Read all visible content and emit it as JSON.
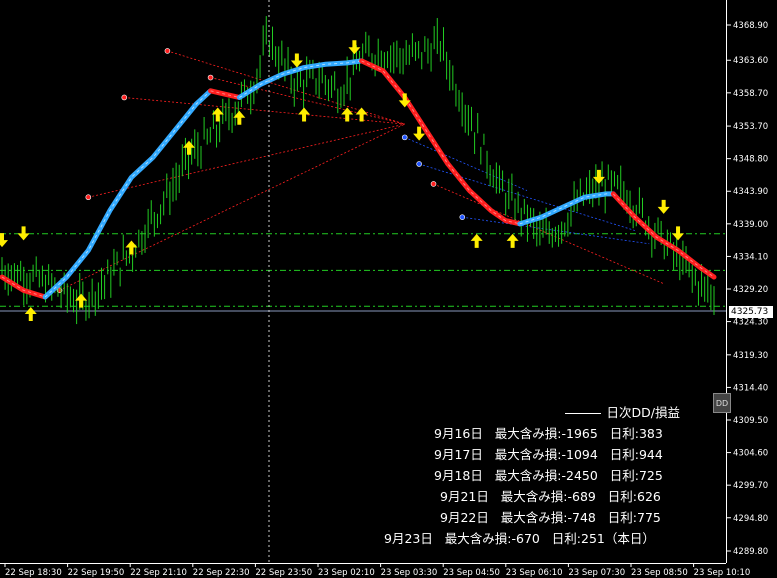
{
  "chart_data": {
    "type": "candlestick",
    "y_ticks": [
      "4368.90",
      "4363.60",
      "4358.70",
      "4353.70",
      "4348.80",
      "4343.90",
      "4339.00",
      "4334.10",
      "4329.20",
      "4324.30",
      "4319.30",
      "4314.40",
      "4309.50",
      "4304.60",
      "4299.70",
      "4294.80",
      "4289.80"
    ],
    "x_ticks": [
      "22 Sep 18:30",
      "22 Sep 19:50",
      "22 Sep 21:10",
      "22 Sep 22:30",
      "22 Sep 23:50",
      "23 Sep 02:10",
      "23 Sep 03:30",
      "23 Sep 04:50",
      "23 Sep 06:10",
      "23 Sep 07:30",
      "23 Sep 08:50",
      "23 Sep 10:10"
    ],
    "ylim": [
      4289.8,
      4372.0
    ],
    "current_price": "4325.73",
    "grid": false,
    "level_lines": [
      4337.5,
      4332.0,
      4326.6,
      4325.9
    ],
    "price_path": [
      [
        0,
        4332
      ],
      [
        4,
        4331
      ],
      [
        8,
        4329
      ],
      [
        11,
        4327
      ],
      [
        14,
        4330
      ],
      [
        18,
        4335
      ],
      [
        21,
        4340
      ],
      [
        24,
        4345
      ],
      [
        26,
        4349
      ],
      [
        29,
        4352
      ],
      [
        32,
        4356
      ],
      [
        35,
        4360
      ],
      [
        37,
        4367
      ],
      [
        39,
        4363
      ],
      [
        41,
        4360
      ],
      [
        44,
        4361
      ],
      [
        47,
        4359
      ],
      [
        50,
        4364
      ],
      [
        53,
        4365
      ],
      [
        56,
        4364
      ],
      [
        59,
        4365
      ],
      [
        61,
        4366
      ],
      [
        63,
        4360
      ],
      [
        65,
        4355
      ],
      [
        67,
        4350
      ],
      [
        69,
        4345
      ],
      [
        71,
        4342
      ],
      [
        73,
        4340
      ],
      [
        75,
        4337
      ],
      [
        78,
        4339
      ],
      [
        80,
        4342
      ],
      [
        82,
        4344
      ],
      [
        84,
        4345
      ],
      [
        86,
        4344
      ],
      [
        88,
        4342
      ],
      [
        90,
        4339
      ],
      [
        93,
        4335
      ],
      [
        96,
        4331
      ],
      [
        99,
        4328
      ]
    ],
    "ma_segments": [
      {
        "color": "#ff2020",
        "points": [
          [
            0,
            4331
          ],
          [
            3,
            4329
          ],
          [
            6,
            4328
          ]
        ]
      },
      {
        "color": "#33aaff",
        "points": [
          [
            6,
            4328
          ],
          [
            9,
            4331
          ],
          [
            12,
            4335
          ],
          [
            15,
            4341
          ],
          [
            18,
            4346
          ],
          [
            21,
            4349
          ],
          [
            24,
            4353
          ],
          [
            27,
            4357
          ],
          [
            29,
            4359
          ]
        ]
      },
      {
        "color": "#ff2020",
        "points": [
          [
            29,
            4359
          ],
          [
            31,
            4358.5
          ],
          [
            33,
            4358
          ]
        ]
      },
      {
        "color": "#33aaff",
        "points": [
          [
            33,
            4358
          ],
          [
            36,
            4360
          ],
          [
            39,
            4361.5
          ],
          [
            42,
            4362.5
          ],
          [
            45,
            4363
          ],
          [
            48,
            4363.2
          ],
          [
            50,
            4363.5
          ]
        ]
      },
      {
        "color": "#ff2020",
        "points": [
          [
            50,
            4363.5
          ],
          [
            53,
            4362
          ],
          [
            56,
            4358
          ],
          [
            59,
            4353
          ],
          [
            62,
            4348
          ],
          [
            65,
            4344
          ],
          [
            68,
            4341
          ],
          [
            70,
            4339.5
          ],
          [
            72,
            4339
          ]
        ]
      },
      {
        "color": "#33aaff",
        "points": [
          [
            72,
            4339
          ],
          [
            75,
            4340
          ],
          [
            78,
            4341.5
          ],
          [
            81,
            4343
          ],
          [
            84,
            4343.5
          ],
          [
            85,
            4343.5
          ]
        ]
      },
      {
        "color": "#ff2020",
        "points": [
          [
            85,
            4343.5
          ],
          [
            88,
            4340
          ],
          [
            91,
            4337
          ],
          [
            94,
            4335
          ],
          [
            97,
            4332.5
          ],
          [
            99,
            4331
          ]
        ]
      }
    ],
    "up_arrows": [
      [
        4,
        4328
      ],
      [
        11,
        4330
      ],
      [
        18,
        4338
      ],
      [
        26,
        4353
      ],
      [
        30,
        4358
      ],
      [
        33,
        4357.5
      ],
      [
        42,
        4358
      ],
      [
        48,
        4358
      ],
      [
        50,
        4358
      ],
      [
        66,
        4339
      ],
      [
        71,
        4339
      ]
    ],
    "down_arrows": [
      [
        0,
        4334
      ],
      [
        3,
        4335
      ],
      [
        41,
        4361
      ],
      [
        49,
        4363
      ],
      [
        56,
        4355
      ],
      [
        58,
        4350
      ],
      [
        83,
        4343.5
      ],
      [
        92,
        4339
      ],
      [
        94,
        4335
      ]
    ],
    "annotation_lines": [
      {
        "color": "#ff2020",
        "from": [
          8,
          4329
        ],
        "to": [
          56,
          4354
        ]
      },
      {
        "color": "#ff2020",
        "from": [
          12,
          4343
        ],
        "to": [
          56,
          4354
        ]
      },
      {
        "color": "#ff2020",
        "from": [
          17,
          4358
        ],
        "to": [
          56,
          4354
        ]
      },
      {
        "color": "#ff2020",
        "from": [
          23,
          4365
        ],
        "to": [
          56,
          4354
        ]
      },
      {
        "color": "#ff2020",
        "from": [
          29,
          4361
        ],
        "to": [
          56,
          4354
        ]
      },
      {
        "color": "#2255ff",
        "from": [
          56,
          4352
        ],
        "to": [
          73,
          4344
        ]
      },
      {
        "color": "#2255ff",
        "from": [
          58,
          4348
        ],
        "to": [
          88,
          4338
        ]
      },
      {
        "color": "#ff2020",
        "from": [
          60,
          4345
        ],
        "to": [
          92,
          4330
        ]
      },
      {
        "color": "#2255ff",
        "from": [
          64,
          4340
        ],
        "to": [
          90,
          4336
        ]
      }
    ]
  },
  "dd_button": "DD",
  "panel": {
    "title": "日次DD/損益",
    "rows": [
      "9月16日   最大含み損:-1965   日利:383",
      "9月17日   最大含み損:-1094   日利:944",
      "9月18日   最大含み損:-2450   日利:725",
      "9月21日   最大含み損:-689   日利:626",
      "9月22日   最大含み損:-748   日利:775",
      "9月23日   最大含み損:-670   日利:251（本日）"
    ]
  },
  "colors": {
    "candle": "#22cc22",
    "up_arrow": "#ffee00",
    "down_arrow": "#ffee00",
    "level": "#22cc22",
    "current": "#8899bb"
  }
}
